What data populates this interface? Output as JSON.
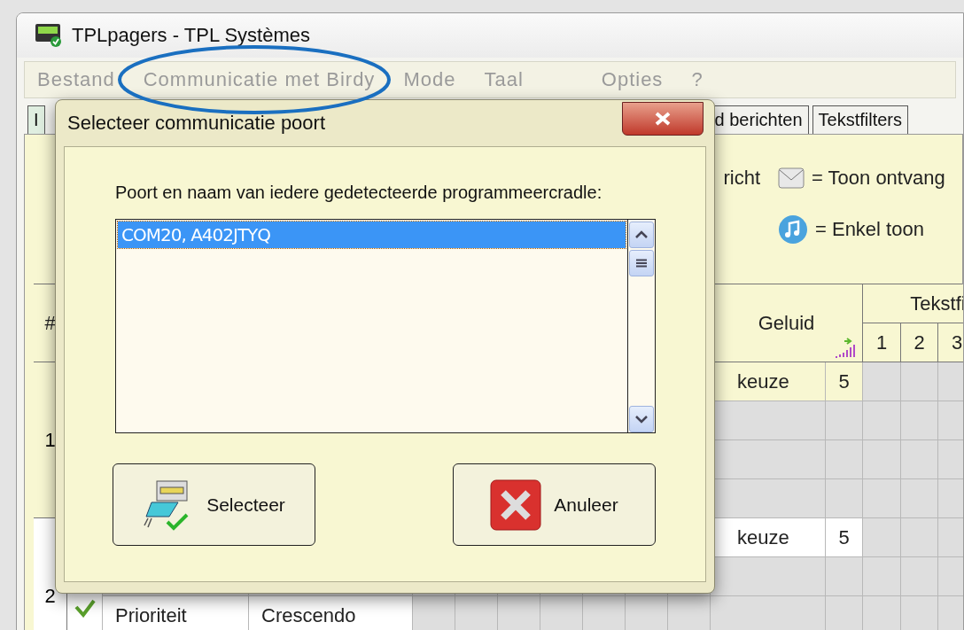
{
  "window": {
    "title": "TPLpagers - TPL Systèmes"
  },
  "menu": [
    {
      "label": "Bestand",
      "disabled": true
    },
    {
      "label": "Communicatie met Birdy",
      "disabled": true
    },
    {
      "label": "Mode",
      "disabled": true
    },
    {
      "label": "Taal",
      "disabled": true
    },
    {
      "label": "Opties",
      "disabled": true
    },
    {
      "label": "?",
      "disabled": true
    }
  ],
  "tabs": [
    {
      "label": "I",
      "selected": true
    },
    {
      "label": "d berichten",
      "selected": false
    },
    {
      "label": "Tekstfilters",
      "selected": false
    }
  ],
  "legend": {
    "cut_text": "richt",
    "items": [
      {
        "kind": "envelope",
        "text": "= Toon ontvang"
      },
      {
        "kind": "music",
        "text": "= Enkel toon"
      }
    ]
  },
  "table": {
    "number_header": "#",
    "sound_header": "Geluid",
    "filter_header": "Tekstfi",
    "filter_columns": [
      "1",
      "2",
      "3"
    ],
    "rows": [
      {
        "number": "1",
        "selected": true,
        "sound": "keuze",
        "volume": "5"
      },
      {
        "number": "2",
        "selected": false,
        "checked": true,
        "sound": "keuze",
        "volume": "5",
        "field_label": "Prioriteit",
        "field_value": "Crescendo"
      }
    ]
  },
  "dialog": {
    "title": "Selecteer communicatie poort",
    "prompt": "Poort en naam van iedere gedetecteerde programmeercradle:",
    "ports": [
      {
        "label": "COM20, A402JTYQ",
        "selected": true
      }
    ],
    "buttons": [
      {
        "kind": "select",
        "label": "Selecteer"
      },
      {
        "kind": "cancel",
        "label": "Anuleer"
      }
    ]
  }
}
